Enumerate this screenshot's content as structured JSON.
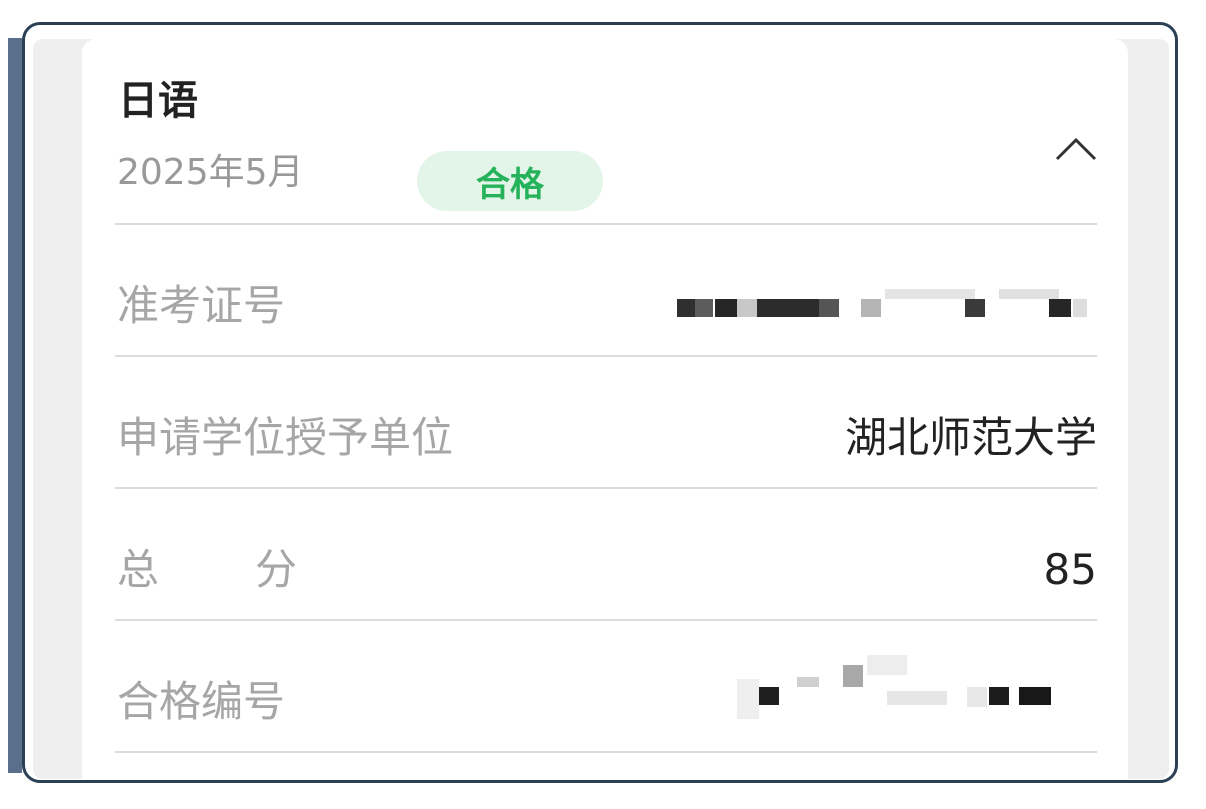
{
  "card": {
    "title": "日语",
    "date": "2025年5月",
    "status_badge": "合格",
    "collapse_icon": "chevron-up-icon"
  },
  "rows": [
    {
      "label": "准考证号",
      "value": ""
    },
    {
      "label": "申请学位授予单位",
      "value": "湖北师范大学"
    },
    {
      "label_part1": "总",
      "label_part2": "分",
      "value": "85"
    },
    {
      "label": "合格编号",
      "value": ""
    }
  ],
  "colors": {
    "badge_bg": "#e3f5e8",
    "badge_text": "#25b25a",
    "frame_border": "#2b3f55",
    "label_gray": "#a6a6a6"
  }
}
